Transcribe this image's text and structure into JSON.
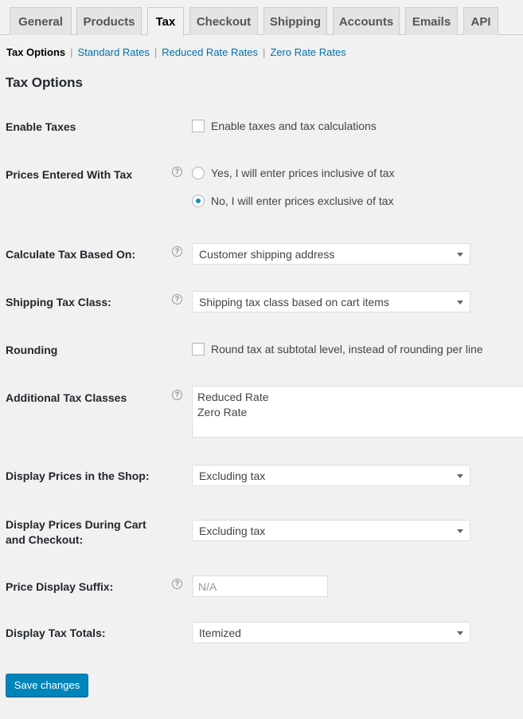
{
  "tabs": [
    {
      "label": "General",
      "active": false
    },
    {
      "label": "Products",
      "active": false
    },
    {
      "label": "Tax",
      "active": true
    },
    {
      "label": "Checkout",
      "active": false
    },
    {
      "label": "Shipping",
      "active": false
    },
    {
      "label": "Accounts",
      "active": false
    },
    {
      "label": "Emails",
      "active": false
    },
    {
      "label": "API",
      "active": false
    }
  ],
  "subnav": {
    "current": "Tax Options",
    "links": [
      "Standard Rates",
      "Reduced Rate Rates",
      "Zero Rate Rates"
    ],
    "separator": "|"
  },
  "section_title": "Tax Options",
  "help_glyph": "?",
  "fields": {
    "enable_taxes": {
      "label": "Enable Taxes",
      "checkbox_label": "Enable taxes and tax calculations",
      "checked": false
    },
    "prices_entered_with_tax": {
      "label": "Prices Entered With Tax",
      "options": [
        {
          "label": "Yes, I will enter prices inclusive of tax",
          "checked": false
        },
        {
          "label": "No, I will enter prices exclusive of tax",
          "checked": true
        }
      ]
    },
    "calculate_tax_based_on": {
      "label": "Calculate Tax Based On:",
      "value": "Customer shipping address"
    },
    "shipping_tax_class": {
      "label": "Shipping Tax Class:",
      "value": "Shipping tax class based on cart items"
    },
    "rounding": {
      "label": "Rounding",
      "checkbox_label": "Round tax at subtotal level, instead of rounding per line",
      "checked": false
    },
    "additional_tax_classes": {
      "label": "Additional Tax Classes",
      "lines": [
        "Reduced Rate",
        "Zero Rate"
      ]
    },
    "display_prices_shop": {
      "label": "Display Prices in the Shop:",
      "value": "Excluding tax"
    },
    "display_prices_cart": {
      "label_line1": "Display Prices During Cart",
      "label_line2": "and Checkout:",
      "value": "Excluding tax"
    },
    "price_display_suffix": {
      "label": "Price Display Suffix:",
      "placeholder": "N/A",
      "value": ""
    },
    "display_tax_totals": {
      "label": "Display Tax Totals:",
      "value": "Itemized"
    }
  },
  "save_button": "Save changes",
  "colors": {
    "accent": "#0085ba",
    "link": "#0073aa",
    "background": "#f1f1f1"
  }
}
